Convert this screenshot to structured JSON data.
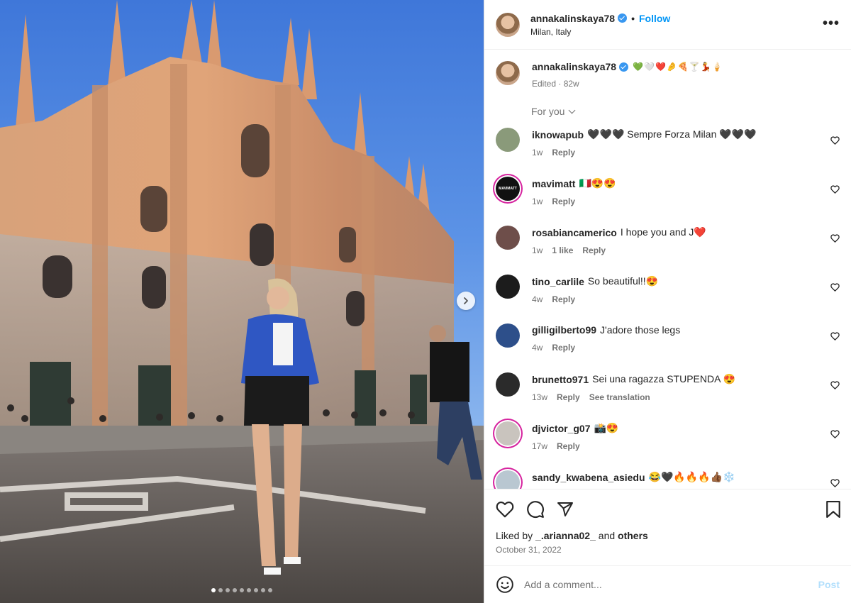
{
  "post": {
    "owner": "annakalinskaya78",
    "location": "Milan, Italy",
    "follow_label": "Follow",
    "separator": "•",
    "more_label": "•••",
    "caption_emojis": "💚🤍❤️🤌🍕🍸💃🍦",
    "caption_meta": "Edited · 82w",
    "media_count": 9,
    "media_active_index": 0
  },
  "for_you": {
    "label": "For you"
  },
  "comments": [
    {
      "user": "iknowapub",
      "text": "🖤🖤🖤 Sempre Forza Milan 🖤🖤🖤",
      "time": "1w",
      "likes": "",
      "reply": "Reply",
      "translate": "",
      "avatar_color": "#8a9a7a"
    },
    {
      "user": "mavimatt",
      "text": "🇮🇹😍😍",
      "time": "1w",
      "likes": "",
      "reply": "Reply",
      "translate": "",
      "avatar_color": "#111111",
      "avatar_text": "MAVIMATT"
    },
    {
      "user": "rosabiancamerico",
      "text": "I hope you and J❤️",
      "time": "1w",
      "likes": "1 like",
      "reply": "Reply",
      "translate": "",
      "avatar_color": "#6e4e4a"
    },
    {
      "user": "tino_carlile",
      "text": "So beautiful!!😍",
      "time": "4w",
      "likes": "",
      "reply": "Reply",
      "translate": "",
      "avatar_color": "#1c1c1c"
    },
    {
      "user": "gilligilberto99",
      "text": "J'adore those legs",
      "time": "4w",
      "likes": "",
      "reply": "Reply",
      "translate": "",
      "avatar_color": "#2d4f8a"
    },
    {
      "user": "brunetto971",
      "text": "Sei una ragazza STUPENDA 😍",
      "time": "13w",
      "likes": "",
      "reply": "Reply",
      "translate": "See translation",
      "avatar_color": "#2b2b2b"
    },
    {
      "user": "djvictor_g07",
      "text": "📸😍",
      "time": "17w",
      "likes": "",
      "reply": "Reply",
      "translate": "",
      "avatar_color": "#c9c4be"
    },
    {
      "user": "sandy_kwabena_asiedu",
      "text": "😂🖤🔥🔥🔥👍🏾❄️",
      "time": "",
      "likes": "",
      "reply": "",
      "translate": "",
      "avatar_color": "#b9c7d1"
    }
  ],
  "likes": {
    "prefix": "Liked by ",
    "user": "_.arianna02_",
    "middle": " and ",
    "others": "others"
  },
  "date": "October 31, 2022",
  "composer": {
    "placeholder": "Add a comment...",
    "post_label": "Post"
  },
  "colors": {
    "accent": "#0095f6",
    "verified": "#3897f0",
    "post_disabled": "#b2dffc"
  },
  "icons": [
    "heart-icon",
    "comment-icon",
    "share-icon",
    "bookmark-icon",
    "emoji-icon",
    "chevron-right-icon",
    "verified-icon",
    "more-icon"
  ]
}
